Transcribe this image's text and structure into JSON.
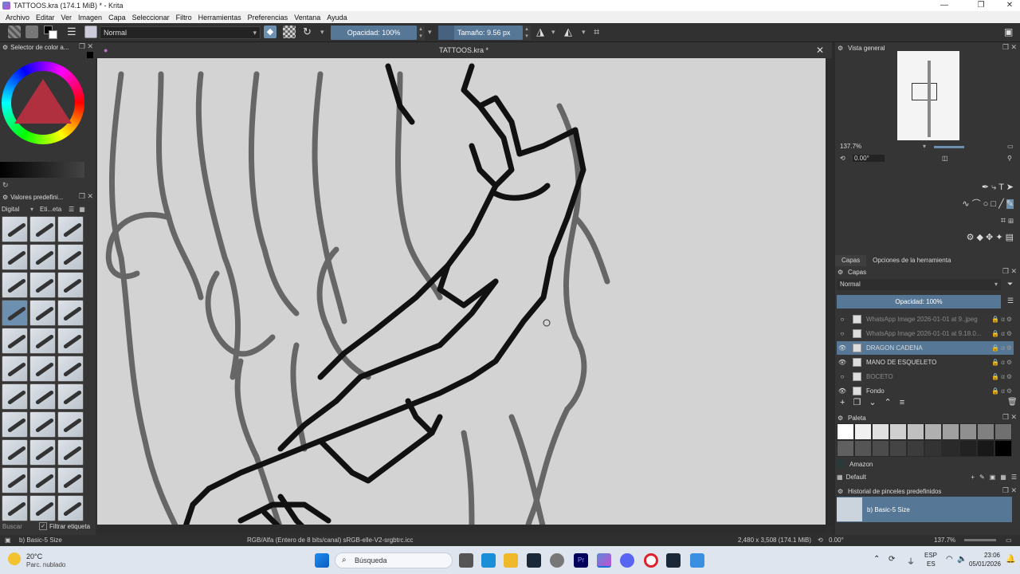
{
  "window": {
    "title": "TATTOOS.kra (174.1 MiB) * - Krita"
  },
  "menu": [
    "Archivo",
    "Editar",
    "Ver",
    "Imagen",
    "Capa",
    "Seleccionar",
    "Filtro",
    "Herramientas",
    "Preferencias",
    "Ventana",
    "Ayuda"
  ],
  "toolbar": {
    "blend_mode": "Normal",
    "opacity": "Opacidad: 100%",
    "size": "Tamaño: 9.56 px"
  },
  "left_panel": {
    "color_selector_title": "Selector de color a...",
    "presets_title": "Valores predefini...",
    "preset_tag": "Digital",
    "etiqueta": "Eti...eta",
    "search_placeholder": "Buscar",
    "filter_tag_label": "Filtrar etiqueta"
  },
  "document": {
    "tab_title": "TATTOOS.kra *"
  },
  "right_panel": {
    "overview_title": "Vista general",
    "zoom": "137.7%",
    "rotation": "0.00°",
    "tabs": [
      "Capas",
      "Opciones de la herramienta"
    ],
    "layers_title": "Capas",
    "layer_blend": "Normal",
    "layer_opacity": "Opacidad: 100%",
    "layers": [
      {
        "name": "WhatsApp Image 2026-01-01 at 9..jpeg",
        "visible": false,
        "selected": false
      },
      {
        "name": "WhatsApp Image 2026-01-01 at 9.18.0...",
        "visible": false,
        "selected": false
      },
      {
        "name": "DRAGON CADENA",
        "visible": true,
        "selected": true
      },
      {
        "name": "MANO DE ESQUELETO",
        "visible": true,
        "selected": false
      },
      {
        "name": "BOCETO",
        "visible": false,
        "selected": false
      },
      {
        "name": "Fondo",
        "visible": true,
        "selected": false
      }
    ],
    "palette_title": "Paleta",
    "palette_name": "Amazon",
    "palette_set": "Default",
    "history_title": "Historial de pinceles predefinidos",
    "history_item": "b) Basic-5 Size"
  },
  "statusbar": {
    "brush": "b) Basic-5 Size",
    "color_space": "RGB/Alfa (Entero de 8 bits/canal)  sRGB-elle-V2-srgbtrc.icc",
    "dimensions": "2,480 x 3,508 (174.1 MiB)",
    "rotation": "0.00°",
    "zoom": "137.7%"
  },
  "taskbar": {
    "weather_temp": "20°C",
    "weather_desc": "Parc. nublado",
    "search": "Búsqueda",
    "lang": "ESP",
    "lang2": "ES",
    "time": "23:06",
    "date": "05/01/2026"
  }
}
